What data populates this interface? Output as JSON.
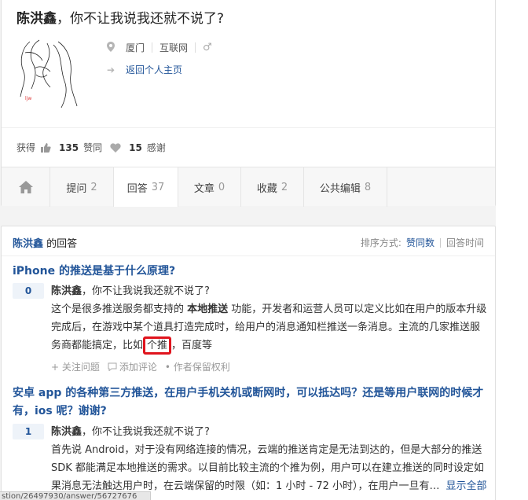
{
  "profile": {
    "name": "陈洪鑫",
    "sep": "，",
    "tagline": "你不让我说我还就不说了?",
    "location": "厦门",
    "industry": "互联网",
    "gender_icon": "male-icon",
    "back_link": "返回个人主页",
    "stats": {
      "label": "获得",
      "agree_count": "135",
      "agree_label": "赞同",
      "thanks_count": "15",
      "thanks_label": "感谢"
    }
  },
  "tabs": [
    {
      "label": "提问",
      "count": "2"
    },
    {
      "label": "回答",
      "count": "37",
      "active": true
    },
    {
      "label": "文章",
      "count": "0"
    },
    {
      "label": "收藏",
      "count": "2"
    },
    {
      "label": "公共编辑",
      "count": "8"
    }
  ],
  "answers": {
    "owner": "陈洪鑫",
    "owner_suffix": " 的回答",
    "sort_label": "排序方式:",
    "sort_options": [
      "赞同数",
      "回答时间"
    ],
    "items": [
      {
        "question": "iPhone 的推送是基于什么原理?",
        "votes": "0",
        "author": "陈洪鑫",
        "author_tagline": "，你不让我说我还就不说了?",
        "text_before": "这个是很多推送服务都支持的 ",
        "text_kw": "本地推送",
        "text_after": " 功能，开发者和运营人员可以定义比如在用户的版本升级完成后，在游戏中某个道具打造完成时，给用户的消息通知栏推送一条消息。主流的几家推送服务商都能搞定，比如",
        "text_highlight": "个推",
        "text_end": "，百度等",
        "actions": [
          "+ 关注问题",
          "添加评论",
          "• 作者保留权利"
        ]
      },
      {
        "question": "安卓 app 的各种第三方推送，在用户手机关机或断网时，可以抵达吗？还是等用户联网的时候才有，ios 呢？谢谢?",
        "votes": "1",
        "author": "陈洪鑫",
        "author_tagline": "，你不让我说我还就不说了?",
        "text": "首先说 Android，对于没有网络连接的情况，云端的推送肯定是无法到达的，但是大部分的推送 SDK 都能满足本地推送的需求。以目前比较主流的个推为例，用户可以在建立推送的同时设定如果消息无法触达用户时，在云端保留的时限（如：1 小时 - 72 小时），在用户一旦有…",
        "more": "显示全部"
      }
    ]
  },
  "status_bar": "stion/26497930/answer/56727676"
}
